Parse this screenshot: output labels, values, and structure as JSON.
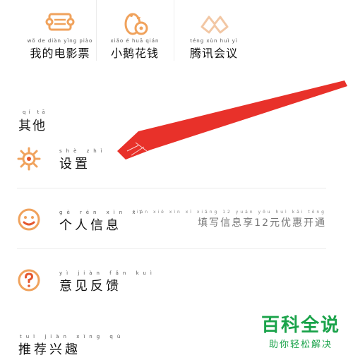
{
  "top_items": [
    {
      "pinyin": "wǒ de diàn yǐng piào",
      "label": "我的电影票",
      "icon": "ticket-icon"
    },
    {
      "pinyin": "xiǎo é huā qián",
      "label": "小鹅花钱",
      "icon": "penguin-coin-icon"
    },
    {
      "pinyin": "téng xùn huì yì",
      "label": "腾讯会议",
      "icon": "meeting-icon"
    }
  ],
  "section": {
    "pinyin": "qí tā",
    "title": "其他"
  },
  "rows": [
    {
      "pinyin": "shè zhì",
      "label": "设置",
      "icon": "gear-icon"
    },
    {
      "pinyin": "gè rén xìn xī",
      "label": "个人信息",
      "icon": "smiley-icon",
      "hint_pinyin": "tián xiě xìn xī xiǎng 12 yuán yōu huì kāi tōng",
      "hint": "填写信息享12元优惠开通"
    },
    {
      "pinyin": "yì jiàn fǎn kuì",
      "label": "意见反馈",
      "icon": "question-icon"
    },
    {
      "pinyin": "tuī jiàn xīng qù",
      "label": "推荐兴趣",
      "icon": ""
    }
  ],
  "watermark": {
    "title": "百科全说",
    "subtitle": "助你轻松解决"
  },
  "colors": {
    "accent": "#f0a25c",
    "arrow": "#e8312a",
    "watermark": "#1aa34a"
  }
}
